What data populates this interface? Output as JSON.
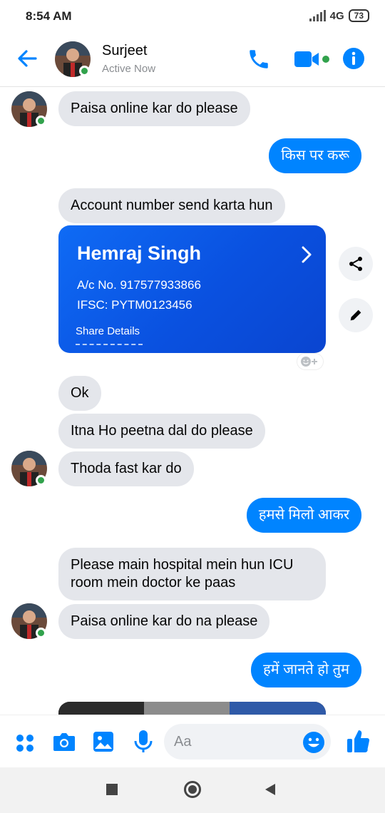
{
  "status": {
    "time": "8:54 AM",
    "network": "4G",
    "battery": "73"
  },
  "header": {
    "name": "Surjeet",
    "presence": "Active Now"
  },
  "messages": {
    "m1": "Paisa online kar do please",
    "m2": "किस पर करू",
    "m3": "Account number send karta hun",
    "m4": "Ok",
    "m5": "Itna Ho peetna dal do please",
    "m6": "Thoda fast kar do",
    "m7": "हमसे मिलो आकर",
    "m8a": "Please main hospital mein hun ICU",
    "m8b": "room mein doctor ke paas",
    "m9": "Paisa online kar do na please",
    "m10": "हमें जानते हो तुम"
  },
  "card": {
    "name": "Hemraj Singh",
    "account": "A/c No. 917577933866",
    "ifsc": "IFSC: PYTM0123456",
    "share": "Share Details"
  },
  "composer": {
    "placeholder": "Aa"
  },
  "colors": {
    "accent": "#0084ff",
    "incoming": "#e4e6eb",
    "online": "#31a24c"
  },
  "icons": [
    "back-arrow-icon",
    "phone-icon",
    "video-icon",
    "info-icon",
    "share-icon",
    "edit-icon",
    "add-reaction-icon",
    "apps-icon",
    "camera-icon",
    "gallery-icon",
    "mic-icon",
    "emoji-icon",
    "like-icon",
    "nav-square-icon",
    "nav-home-icon",
    "nav-back-icon"
  ]
}
